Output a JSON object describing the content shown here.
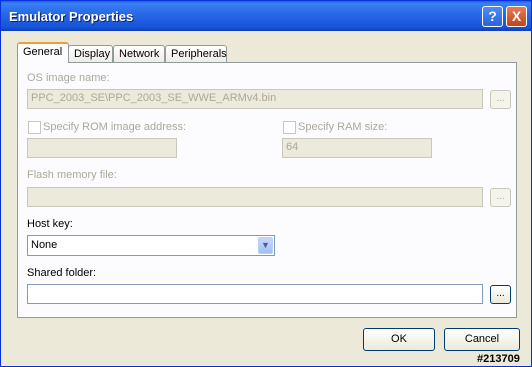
{
  "window": {
    "title": "Emulator Properties"
  },
  "titlebar": {
    "help_glyph": "?",
    "close_glyph": "X"
  },
  "tabs": [
    {
      "label": "General"
    },
    {
      "label": "Display"
    },
    {
      "label": "Network"
    },
    {
      "label": "Peripherals"
    }
  ],
  "general": {
    "os_image": {
      "label": "OS image name:",
      "value": "PPC_2003_SE\\PPC_2003_SE_WWE_ARMv4.bin",
      "browse": "..."
    },
    "rom_address": {
      "label": "Specify ROM image address:",
      "value": ""
    },
    "ram_size": {
      "label": "Specify RAM size:",
      "value": "64"
    },
    "flash_file": {
      "label": "Flash memory file:",
      "value": "",
      "browse": "..."
    },
    "host_key": {
      "label": "Host key:",
      "value": "None",
      "arrow": "▼"
    },
    "shared_folder": {
      "label": "Shared folder:",
      "value": "",
      "browse": "..."
    }
  },
  "footer": {
    "ok_label": "OK",
    "cancel_label": "Cancel"
  },
  "watermark": "#213709",
  "colors": {
    "titlebar": "#1c5fe0",
    "dialog_bg": "#ece9d8",
    "panel_bg": "#fcfcfe",
    "disabled_text": "#aca899"
  }
}
